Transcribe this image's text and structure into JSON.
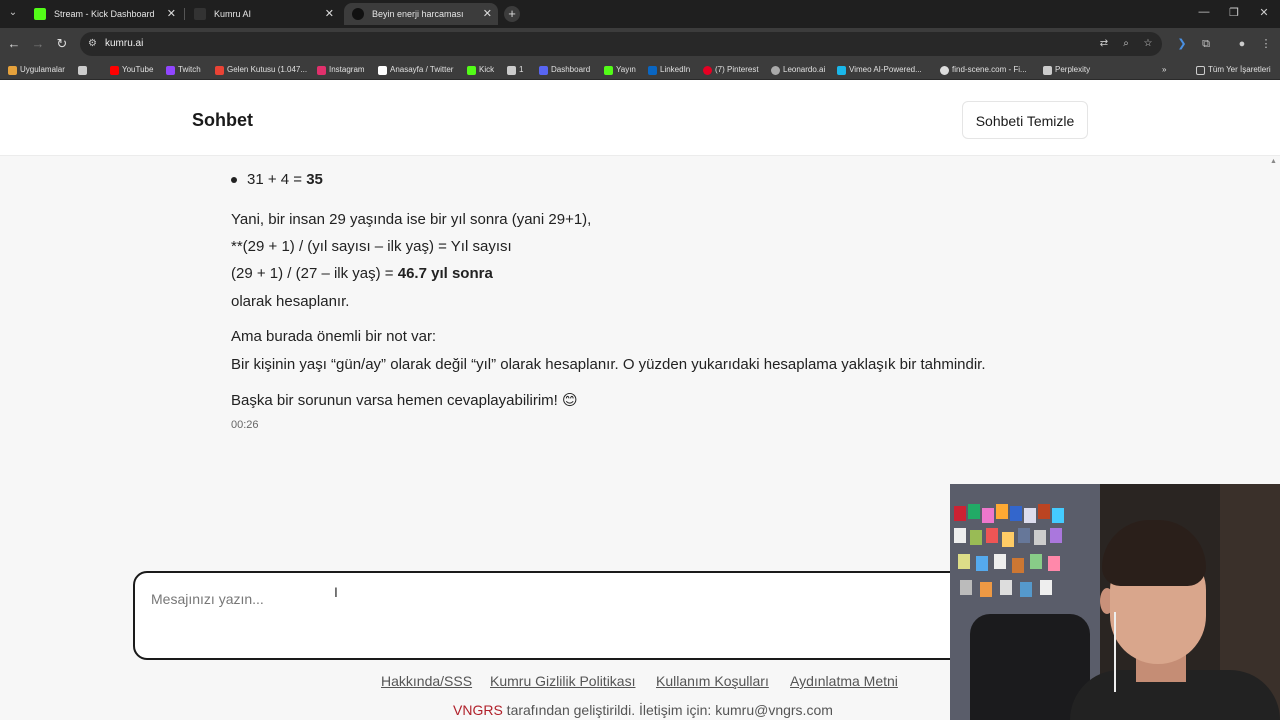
{
  "browser": {
    "tabs": [
      {
        "title": "Stream - Kick Dashboard",
        "active": false,
        "color": "#53fc18"
      },
      {
        "title": "Kumru AI",
        "active": false,
        "color": "#333333"
      },
      {
        "title": "Beyin enerji harcaması",
        "active": true,
        "color": "#111111"
      }
    ],
    "url": "kumru.ai",
    "bookmarks": [
      {
        "label": "Uygulamalar",
        "icon": "apps-grid-icon",
        "color": "#e6a23c"
      },
      {
        "label": "",
        "icon": "grid-icon",
        "color": "#cccccc"
      },
      {
        "label": "YouTube",
        "icon": "youtube-icon",
        "color": "#ff0000"
      },
      {
        "label": "Twitch",
        "icon": "twitch-icon",
        "color": "#9146ff"
      },
      {
        "label": "Gelen Kutusu (1.047...",
        "icon": "gmail-icon",
        "color": "#ea4335"
      },
      {
        "label": "Instagram",
        "icon": "instagram-icon",
        "color": "#e1306c"
      },
      {
        "label": "Anasayfa / Twitter",
        "icon": "x-icon",
        "color": "#ffffff"
      },
      {
        "label": "Kick",
        "icon": "kick-icon",
        "color": "#53fc18"
      },
      {
        "label": "1",
        "icon": "folder-icon",
        "color": "#cccccc"
      },
      {
        "label": "Dashboard",
        "icon": "dashboard-icon",
        "color": "#5865f2"
      },
      {
        "label": "Yayın",
        "icon": "kick-icon",
        "color": "#53fc18"
      },
      {
        "label": "LinkedIn",
        "icon": "linkedin-icon",
        "color": "#0a66c2"
      },
      {
        "label": "(7) Pinterest",
        "icon": "pinterest-icon",
        "color": "#e60023"
      },
      {
        "label": "Leonardo.ai",
        "icon": "leonardo-icon",
        "color": "#aaaaaa"
      },
      {
        "label": "Vimeo AI-Powered...",
        "icon": "vimeo-icon",
        "color": "#1ab7ea"
      },
      {
        "label": "find-scene.com - Fi...",
        "icon": "find-scene-icon",
        "color": "#dddddd"
      },
      {
        "label": "Perplexity",
        "icon": "perplexity-icon",
        "color": "#cccccc"
      }
    ],
    "all_bookmarks": "Tüm Yer İşaretleri"
  },
  "header": {
    "title": "Sohbet",
    "clear_button": "Sohbeti Temizle"
  },
  "chat": {
    "bullet_prefix": "31 + 4 = ",
    "bullet_result": "35",
    "para1_line1": "Yani, bir insan 29 yaşında ise bir yıl sonra (yani 29+1),",
    "para1_line2": "**(29 + 1) / (yıl sayısı – ilk yaş) = Yıl sayısı",
    "para1_line3_prefix": "(29 + 1) / (27 – ilk yaş) = ",
    "para1_line3_bold": "46.7 yıl sonra",
    "para1_line4": "olarak hesaplanır.",
    "para2_line1": "Ama burada önemli bir not var:",
    "para2_line2": "Bir kişinin yaşı “gün/ay” olarak değil “yıl” olarak hesaplanır. O yüzden yukarıdaki hesaplama yaklaşık bir tahmindir.",
    "para3": "Başka bir sorunun varsa hemen cevaplayabilirim! 😊",
    "timestamp": "00:26"
  },
  "input": {
    "placeholder": "Mesajınızı yazın..."
  },
  "footer": {
    "links": [
      "Hakkında/SSS",
      "Kumru Gizlilik Politikası",
      "Kullanım Koşulları",
      "Aydınlatma Metni"
    ],
    "brand": "VNGRS",
    "credit": " tarafından geliştirildi. İletişim için: kumru@vngrs.com"
  }
}
